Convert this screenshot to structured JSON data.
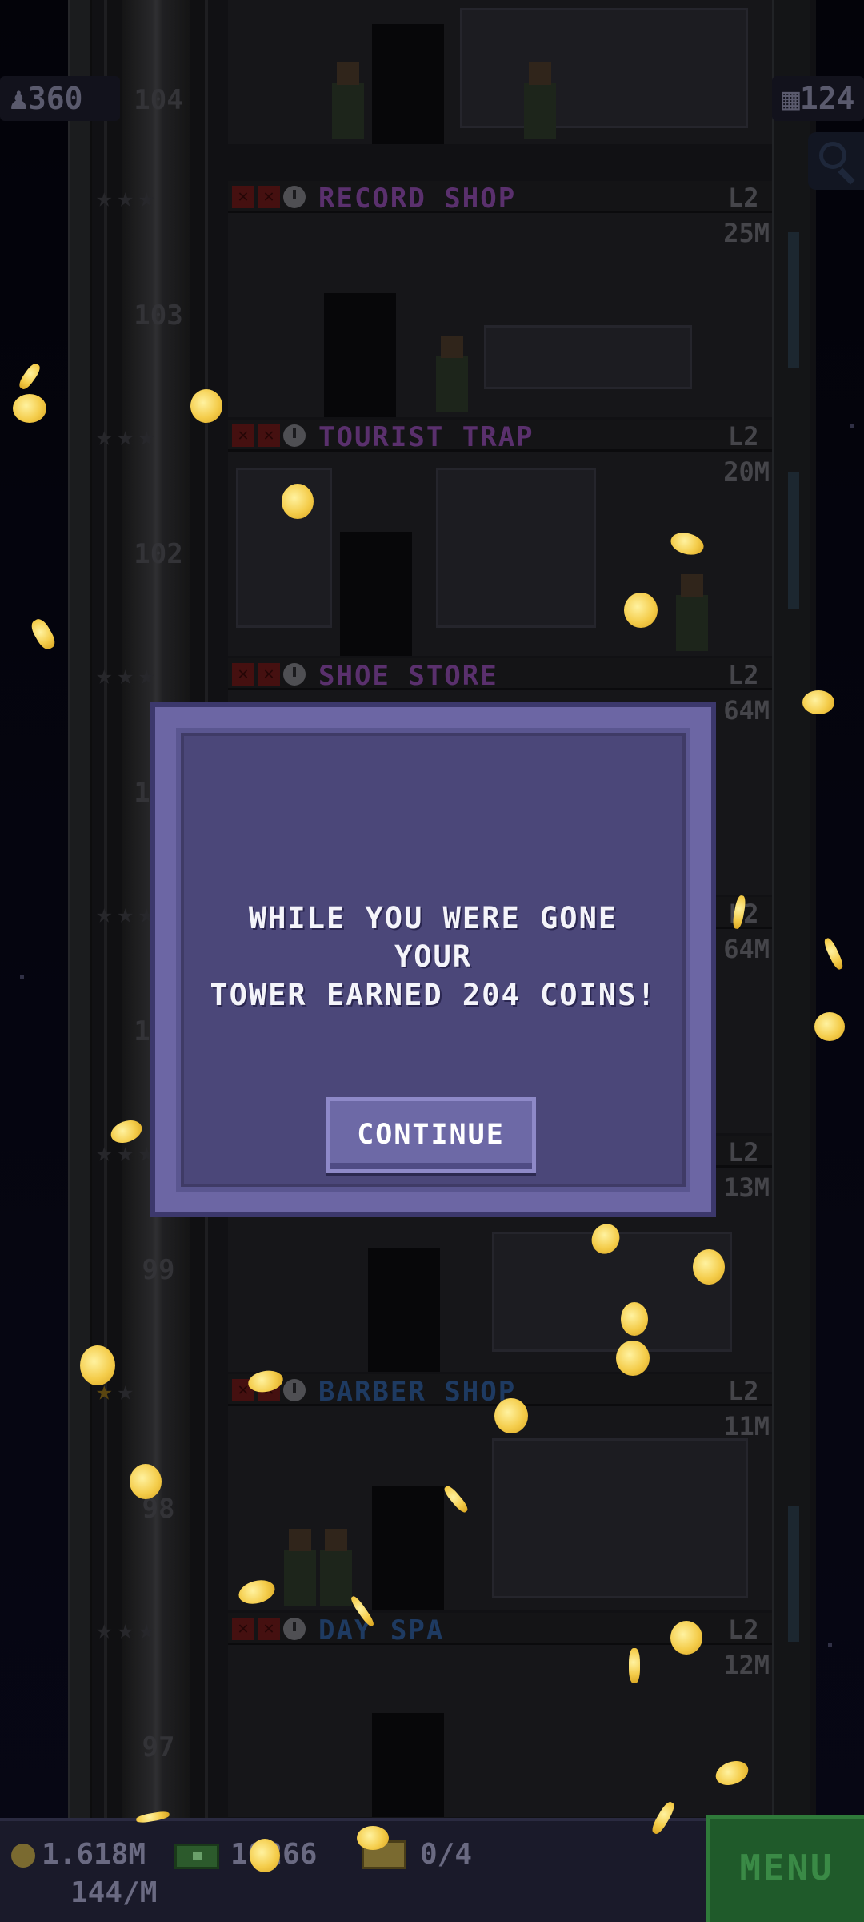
{
  "hud": {
    "population": "360",
    "floors": "124"
  },
  "floors": [
    {
      "number": "104",
      "name": "",
      "level": "",
      "cost": "",
      "name_color": "#b46ad4"
    },
    {
      "number": "103",
      "name": "RECORD SHOP",
      "level": "L2",
      "cost": "25M",
      "name_color": "#9b5ac0"
    },
    {
      "number": "102",
      "name": "TOURIST TRAP",
      "level": "L2",
      "cost": "20M",
      "name_color": "#9b5ac0"
    },
    {
      "number": "101",
      "name": "SHOE STORE",
      "level": "L2",
      "cost": "64M",
      "name_color": "#9b5ac0"
    },
    {
      "number": "100",
      "name": "",
      "level": "L2",
      "cost": "64M",
      "name_color": "#9b5ac0"
    },
    {
      "number": "99",
      "name": "",
      "level": "L2",
      "cost": "13M",
      "name_color": "#5a7ad0"
    },
    {
      "number": "98",
      "name": "BARBER SHOP",
      "level": "L2",
      "cost": "11M",
      "name_color": "#3a6ab0"
    },
    {
      "number": "97",
      "name": "DAY SPA",
      "level": "L2",
      "cost": "12M",
      "name_color": "#3a6ab0"
    }
  ],
  "modal": {
    "message_line1": "WHILE YOU WERE GONE YOUR",
    "message_line2": "TOWER EARNED 204 COINS!",
    "continue_label": "CONTINUE"
  },
  "bottom_bar": {
    "coins": "1.618M",
    "coins_rate": "144/M",
    "bux": "10266",
    "mail": "0/4",
    "menu_label": "MENU"
  },
  "colors": {
    "modal_border": "#6c66a4",
    "modal_inner": "#4b4779",
    "coin": "#f4cc4a",
    "menu": "#1f5a2a"
  }
}
